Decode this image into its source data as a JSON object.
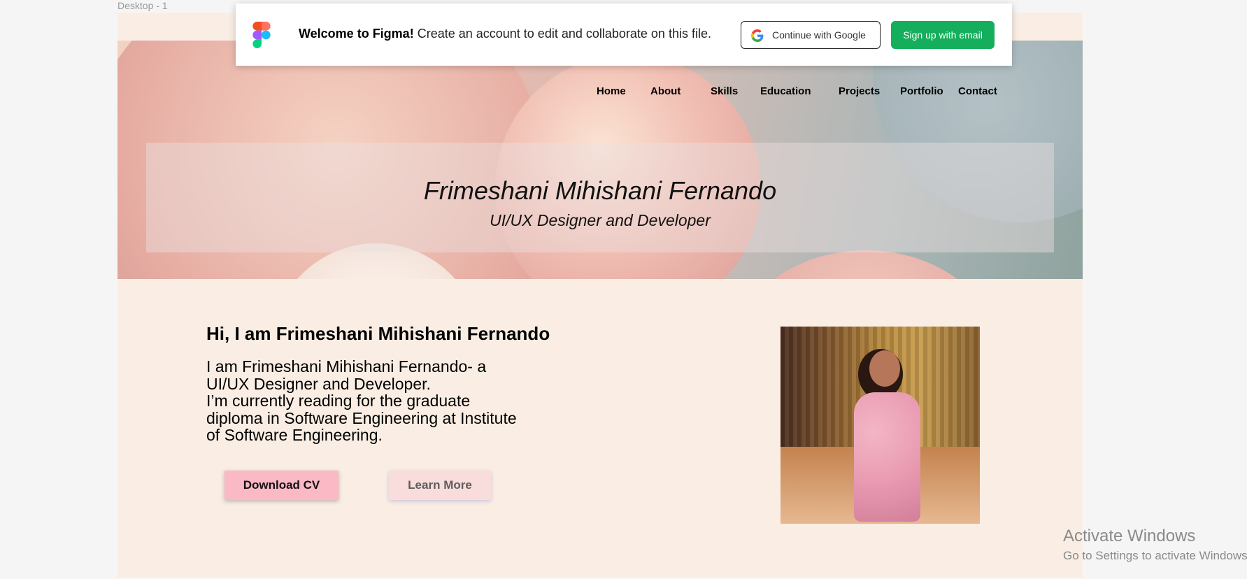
{
  "canvas": {
    "frame_label": "Desktop - 1"
  },
  "banner": {
    "welcome_bold": "Welcome to Figma!",
    "welcome_text": " Create an account to edit and collaborate on this file.",
    "google_label": "Continue with Google",
    "email_label": "Sign up with email",
    "email_color": "#14ae5c"
  },
  "nav": {
    "items": [
      {
        "label": "Home"
      },
      {
        "label": "About"
      },
      {
        "label": "Skills"
      },
      {
        "label": "Education"
      },
      {
        "label": "Projects"
      },
      {
        "label": "Portfolio"
      },
      {
        "label": "Contact"
      }
    ]
  },
  "hero": {
    "name": "Frimeshani Mihishani Fernando",
    "role": "UI/UX Designer and Developer"
  },
  "about": {
    "greeting": "Hi, I am Frimeshani Mihishani Fernando",
    "bio_lines": [
      "I am Frimeshani Mihishani Fernando- a",
      "UI/UX Designer and Developer.",
      "I’m currently reading for the graduate",
      "diploma in Software Engineering at Institute",
      "of Software Engineering."
    ],
    "download_label": "Download CV",
    "learn_more_label": "Learn More"
  },
  "watermark": {
    "title": "Activate Windows",
    "subtitle": "Go to Settings to activate Windows."
  }
}
